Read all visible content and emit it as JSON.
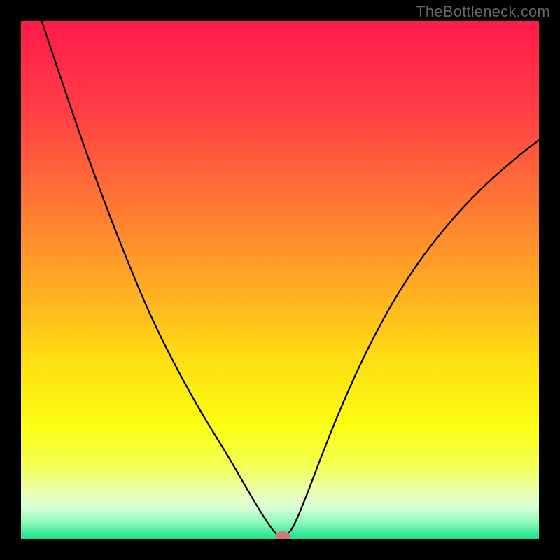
{
  "watermark": "TheBottleneck.com",
  "chart_data": {
    "type": "line",
    "title": "",
    "xlabel": "",
    "ylabel": "",
    "xlim": [
      0,
      100
    ],
    "ylim": [
      0,
      100
    ],
    "grid": false,
    "series": [
      {
        "name": "curve",
        "x": [
          4,
          10,
          15,
          20,
          25,
          30,
          35,
          40,
          44,
          47,
          49.5,
          51,
          52.5,
          55,
          58,
          62,
          67,
          73,
          80,
          88,
          96,
          100
        ],
        "y": [
          100,
          82,
          68,
          55,
          43,
          33,
          24,
          16,
          9,
          4,
          0.5,
          0.5,
          2,
          8,
          16,
          26,
          37,
          48,
          58,
          67,
          74,
          77
        ]
      }
    ],
    "marker": {
      "x": 50.5,
      "y": 0.6,
      "rx": 1.4,
      "ry": 0.9,
      "color": "#cf7a78"
    },
    "background_gradient": {
      "stops": [
        {
          "offset": 0,
          "color": "#ff1a4b"
        },
        {
          "offset": 18,
          "color": "#ff4044"
        },
        {
          "offset": 36,
          "color": "#ff7a33"
        },
        {
          "offset": 52,
          "color": "#ffae22"
        },
        {
          "offset": 66,
          "color": "#ffe013"
        },
        {
          "offset": 78,
          "color": "#fbff10"
        },
        {
          "offset": 86,
          "color": "#f3ff55"
        },
        {
          "offset": 91,
          "color": "#ecffb5"
        },
        {
          "offset": 94,
          "color": "#d7ffd7"
        },
        {
          "offset": 97,
          "color": "#86f9b8"
        },
        {
          "offset": 100,
          "color": "#19e28a"
        }
      ]
    },
    "border_color": "#000000",
    "curve_color": "#000000",
    "curve_width": 2.3
  }
}
